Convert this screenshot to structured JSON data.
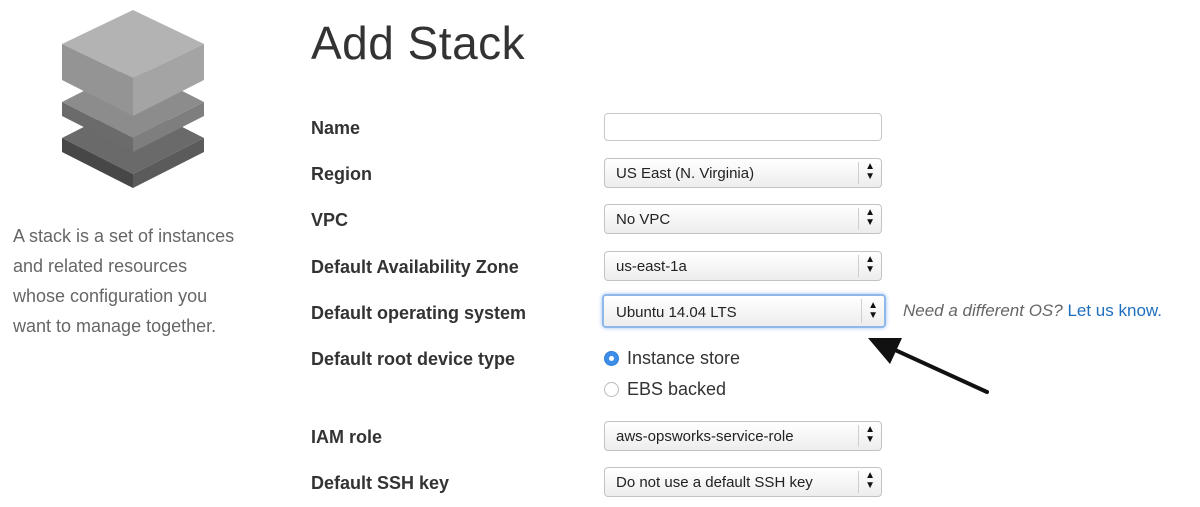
{
  "sidebar": {
    "logo_icon": "layered-stack-icon",
    "description_lines": [
      "A stack is a set of instances",
      "and related resources",
      "whose configuration you",
      "want to manage together."
    ]
  },
  "page": {
    "title": "Add Stack"
  },
  "form": {
    "name": {
      "label": "Name",
      "value": ""
    },
    "region": {
      "label": "Region",
      "value": "US East (N. Virginia)"
    },
    "vpc": {
      "label": "VPC",
      "value": "No VPC"
    },
    "availability_zone": {
      "label": "Default Availability Zone",
      "value": "us-east-1a"
    },
    "operating_system": {
      "label": "Default operating system",
      "value": "Ubuntu 14.04 LTS",
      "hint_text": "Need a different OS?",
      "hint_link": "Let us know."
    },
    "root_device": {
      "label": "Default root device type",
      "options": [
        "Instance store",
        "EBS backed"
      ],
      "selected": "Instance store"
    },
    "iam_role": {
      "label": "IAM role",
      "value": "aws-opsworks-service-role"
    },
    "ssh_key": {
      "label": "Default SSH key",
      "value": "Do not use a default SSH key"
    }
  },
  "colors": {
    "link": "#1f6fbf",
    "radio_accent": "#3d8ee8",
    "focus_ring": "#8fb7ea"
  },
  "annotation": {
    "icon": "arrow-pointer-icon"
  }
}
